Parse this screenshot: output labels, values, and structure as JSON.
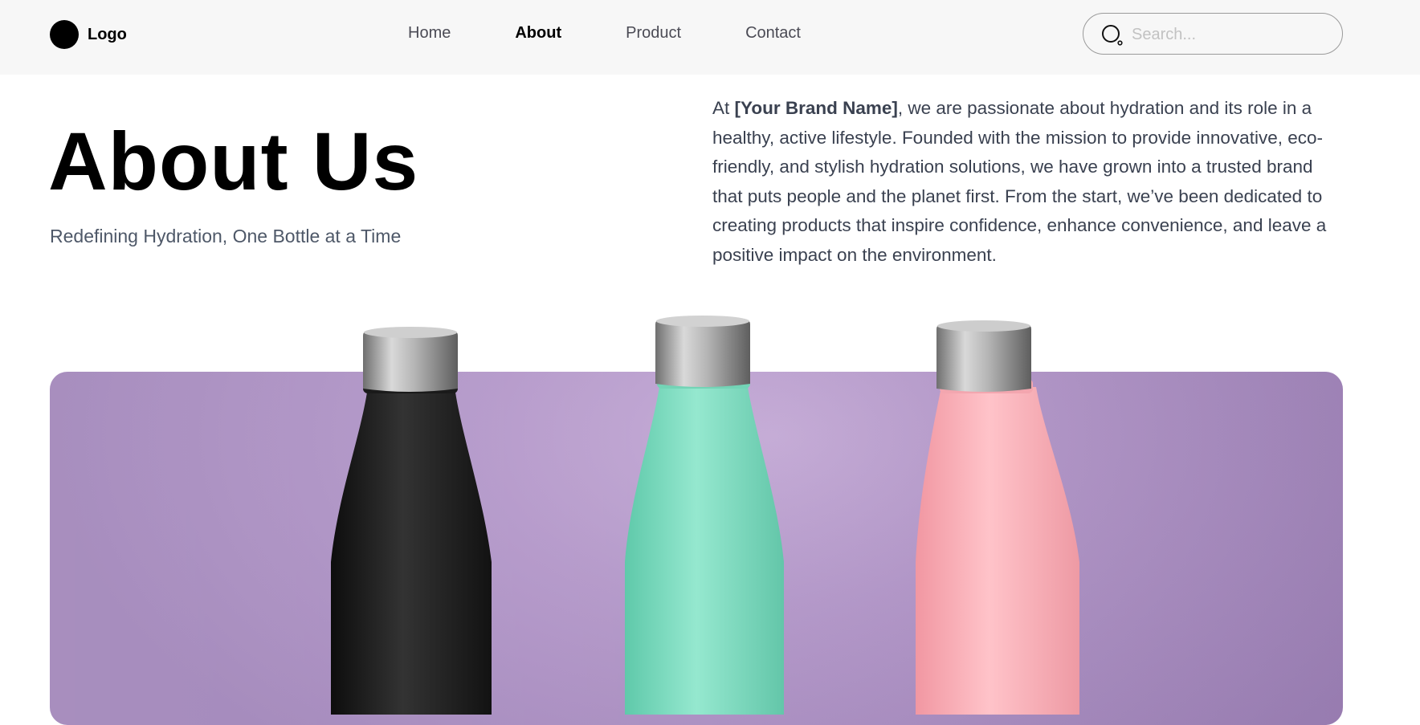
{
  "header": {
    "logo_label": "Logo",
    "nav": [
      {
        "label": "Home",
        "active": false
      },
      {
        "label": "About",
        "active": true
      },
      {
        "label": "Product",
        "active": false
      },
      {
        "label": "Contact",
        "active": false
      }
    ],
    "search": {
      "placeholder": "Search...",
      "value": ""
    }
  },
  "hero": {
    "title": "About Us",
    "subtitle": "Redefining Hydration, One Bottle at a Time"
  },
  "about": {
    "intro_prefix": "At ",
    "brand_name": "[Your Brand Name]",
    "body": ", we are passionate about hydration and its role in a healthy, active lifestyle. Founded with the mission to provide innovative, eco-friendly, and stylish hydration solutions, we have grown into a trusted brand that puts people and the planet first. From the start, we’ve been dedicated to creating products that inspire confidence, enhance convenience, and leave a positive impact on the environment."
  },
  "banner": {
    "background_color": "#b69bcb",
    "bottles": [
      {
        "name": "black-bottle",
        "color": "#1f1f1f"
      },
      {
        "name": "mint-bottle",
        "color": "#86e2c6"
      },
      {
        "name": "pink-bottle",
        "color": "#fbb0b8"
      }
    ],
    "cap_color": "#a8a8a8"
  }
}
